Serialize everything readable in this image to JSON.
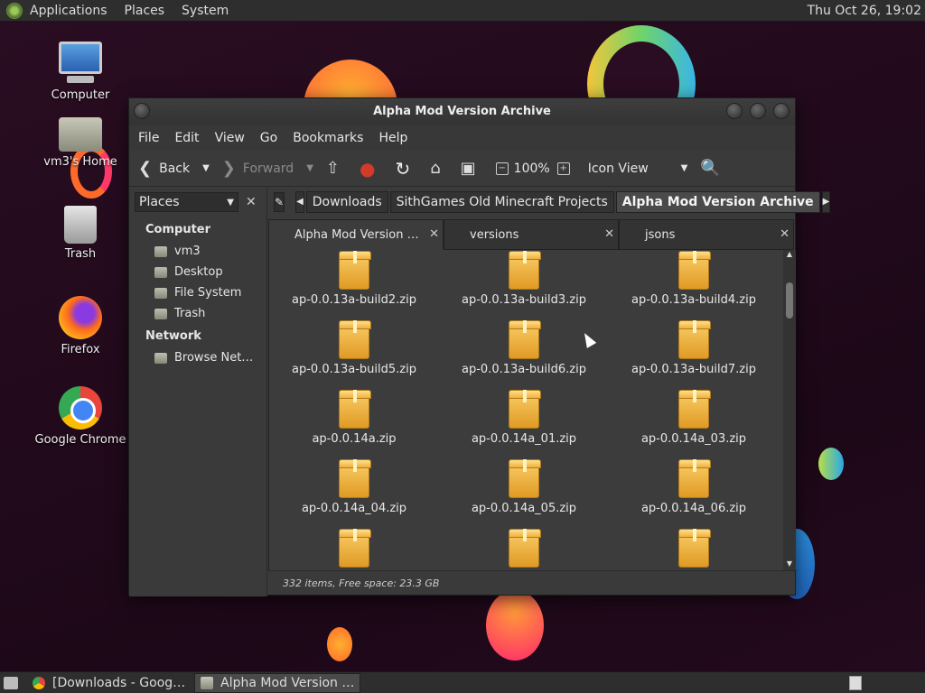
{
  "top_panel": {
    "menus": [
      "Applications",
      "Places",
      "System"
    ],
    "clock": "Thu Oct 26, 19:02"
  },
  "desktop": {
    "icons": [
      {
        "label": "Computer",
        "icon": "computer-icon"
      },
      {
        "label": "vm3's Home",
        "icon": "home-folder-icon"
      },
      {
        "label": "Trash",
        "icon": "trash-icon"
      },
      {
        "label": "Firefox",
        "icon": "firefox-icon"
      },
      {
        "label": "Google Chrome",
        "icon": "chrome-icon"
      }
    ]
  },
  "window": {
    "title": "Alpha Mod Version Archive",
    "menubar": [
      "File",
      "Edit",
      "View",
      "Go",
      "Bookmarks",
      "Help"
    ],
    "toolbar": {
      "back": "Back",
      "forward": "Forward",
      "zoom": "100%",
      "view_mode": "Icon View"
    },
    "sidepane": {
      "selector": "Places",
      "sections": [
        {
          "title": "Computer",
          "items": [
            "vm3",
            "Desktop",
            "File System",
            "Trash"
          ]
        },
        {
          "title": "Network",
          "items": [
            "Browse Net…"
          ]
        }
      ]
    },
    "pathbar": {
      "crumbs": [
        "Downloads",
        "SithGames Old Minecraft Projects",
        "Alpha Mod Version Archive"
      ]
    },
    "tabs": [
      "Alpha Mod Version …",
      "versions",
      "jsons"
    ],
    "files": [
      "ap-0.0.13a-build2.zip",
      "ap-0.0.13a-build3.zip",
      "ap-0.0.13a-build4.zip",
      "ap-0.0.13a-build5.zip",
      "ap-0.0.13a-build6.zip",
      "ap-0.0.13a-build7.zip",
      "ap-0.0.14a.zip",
      "ap-0.0.14a_01.zip",
      "ap-0.0.14a_03.zip",
      "ap-0.0.14a_04.zip",
      "ap-0.0.14a_05.zip",
      "ap-0.0.14a_06.zip",
      "",
      "",
      ""
    ],
    "status": "332 items, Free space: 23.3 GB"
  },
  "bottom_panel": {
    "tasks": [
      "[Downloads - Goog…",
      "Alpha Mod Version …"
    ]
  }
}
